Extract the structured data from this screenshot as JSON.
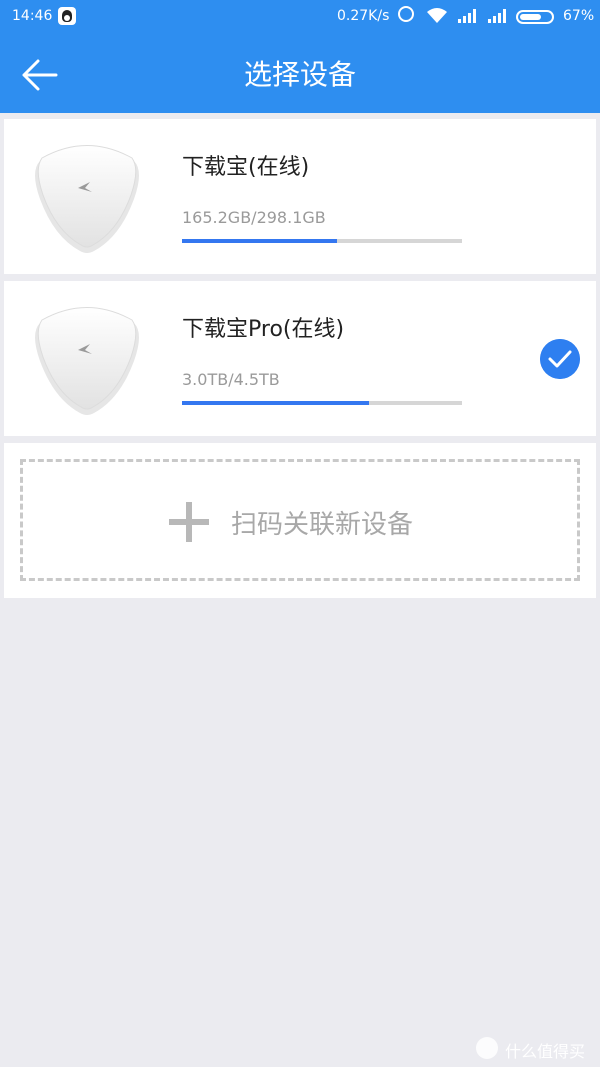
{
  "status_bar": {
    "time": "14:46",
    "speed": "0.27K/s",
    "battery": "67%",
    "battery_level": 0.67
  },
  "header": {
    "title": "选择设备"
  },
  "devices": [
    {
      "name": "下载宝(在线)",
      "storage": "165.2GB/298.1GB",
      "usage_fraction": 0.554,
      "selected": false
    },
    {
      "name": "下载宝Pro(在线)",
      "storage": "3.0TB/4.5TB",
      "usage_fraction": 0.667,
      "selected": true
    }
  ],
  "add_device": {
    "label": "扫码关联新设备"
  },
  "watermark": {
    "text": "什么值得买"
  },
  "colors": {
    "accent": "#2e8ef0",
    "progress": "#3477f0",
    "background": "#ebebf0"
  }
}
